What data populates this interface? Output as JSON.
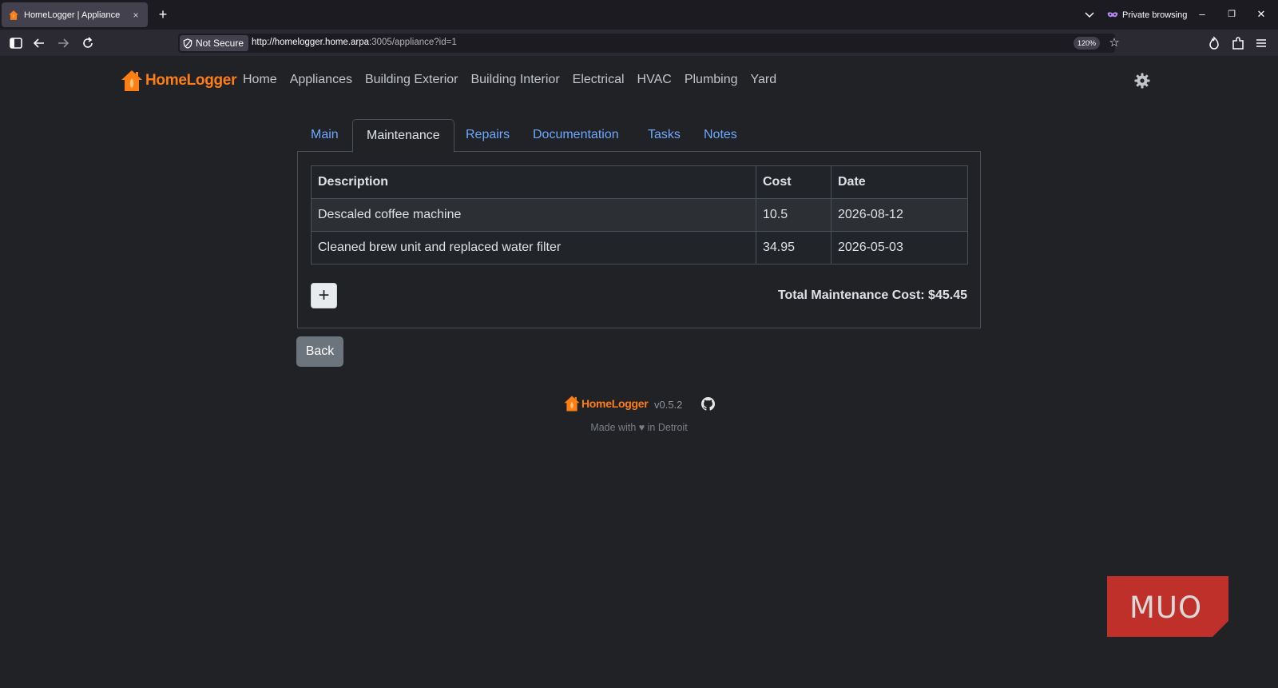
{
  "browser": {
    "tab_title": "HomeLogger | Appliance",
    "tab_close": "×",
    "new_tab": "+",
    "private_label": "Private browsing",
    "security_label": "Not Secure",
    "url_host": "http://homelogger.home.arpa",
    "url_rest": ":3005/appliance?id=1",
    "zoom": "120%",
    "minimize": "–",
    "maximize": "❐",
    "close": "✕"
  },
  "app": {
    "brand": "HomeLogger",
    "nav": [
      "Home",
      "Appliances",
      "Building Exterior",
      "Building Interior",
      "Electrical",
      "HVAC",
      "Plumbing",
      "Yard"
    ],
    "accent_color": "#fd7e14",
    "link_color": "#6ea8fe"
  },
  "tabs": [
    {
      "label": "Main",
      "active": false
    },
    {
      "label": "Maintenance",
      "active": true
    },
    {
      "label": "Repairs",
      "active": false
    },
    {
      "label": "Documentation",
      "active": false
    },
    {
      "label": "Tasks",
      "active": false
    },
    {
      "label": "Notes",
      "active": false
    }
  ],
  "maintenance": {
    "headers": [
      "Description",
      "Cost",
      "Date"
    ],
    "rows": [
      [
        "Descaled coffee machine",
        "10.5",
        "2026-08-12"
      ],
      [
        "Cleaned brew unit and replaced water filter",
        "34.95",
        "2026-05-03"
      ]
    ],
    "add_label": "+",
    "total_label": "Total Maintenance Cost: $45.45"
  },
  "back_label": "Back",
  "footer": {
    "brand": "HomeLogger",
    "version": "v0.5.2",
    "made_with": "Made with ♥ in Detroit"
  },
  "watermark": "MUO"
}
